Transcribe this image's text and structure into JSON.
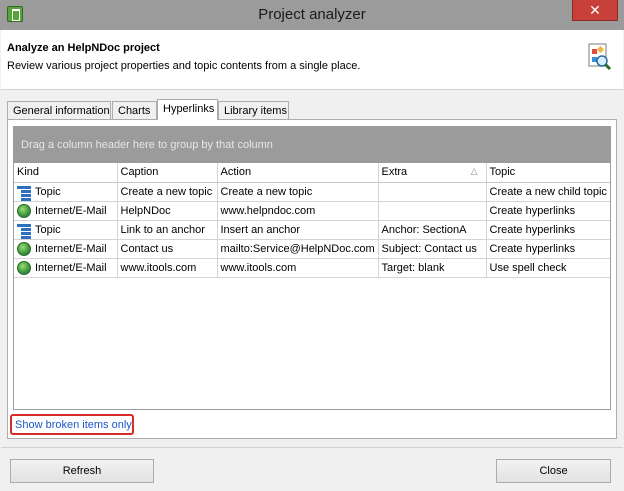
{
  "window": {
    "title": "Project analyzer",
    "close_glyph": "✕"
  },
  "header": {
    "title": "Analyze an HelpNDoc project",
    "description": "Review various project properties and topic contents from a single place."
  },
  "tabs": [
    {
      "label": "General information"
    },
    {
      "label": "Charts"
    },
    {
      "label": "Hyperlinks"
    },
    {
      "label": "Library items"
    }
  ],
  "grid": {
    "group_hint": "Drag a column header here to group by that column",
    "sort_glyph": "△",
    "columns": [
      "Kind",
      "Caption",
      "Action",
      "Extra",
      "Topic"
    ],
    "rows": [
      {
        "icon": "topic-icon",
        "kind": "Topic",
        "caption": "Create a new topic",
        "action": "Create a new topic",
        "extra": "",
        "topic": "Create a new child topic"
      },
      {
        "icon": "globe-icon",
        "kind": "Internet/E-Mail",
        "caption": "HelpNDoc",
        "action": "www.helpndoc.com",
        "extra": "",
        "topic": "Create hyperlinks"
      },
      {
        "icon": "topic-icon",
        "kind": "Topic",
        "caption": "Link to an anchor",
        "action": "Insert an anchor",
        "extra": "Anchor: SectionA",
        "topic": "Create hyperlinks"
      },
      {
        "icon": "globe-icon",
        "kind": "Internet/E-Mail",
        "caption": "Contact us",
        "action": "mailto:Service@HelpNDoc.com",
        "extra": "Subject: Contact us",
        "topic": "Create hyperlinks"
      },
      {
        "icon": "globe-icon",
        "kind": "Internet/E-Mail",
        "caption": "www.itools.com",
        "action": "www.itools.com",
        "extra": "Target: blank",
        "topic": "Use spell check"
      }
    ]
  },
  "filter_link": "Show broken items only",
  "buttons": {
    "refresh": "Refresh",
    "close": "Close"
  },
  "colors": {
    "accent_link": "#1b57c6",
    "highlight_border": "#d92b2b",
    "group_panel": "#9b9b9b"
  }
}
